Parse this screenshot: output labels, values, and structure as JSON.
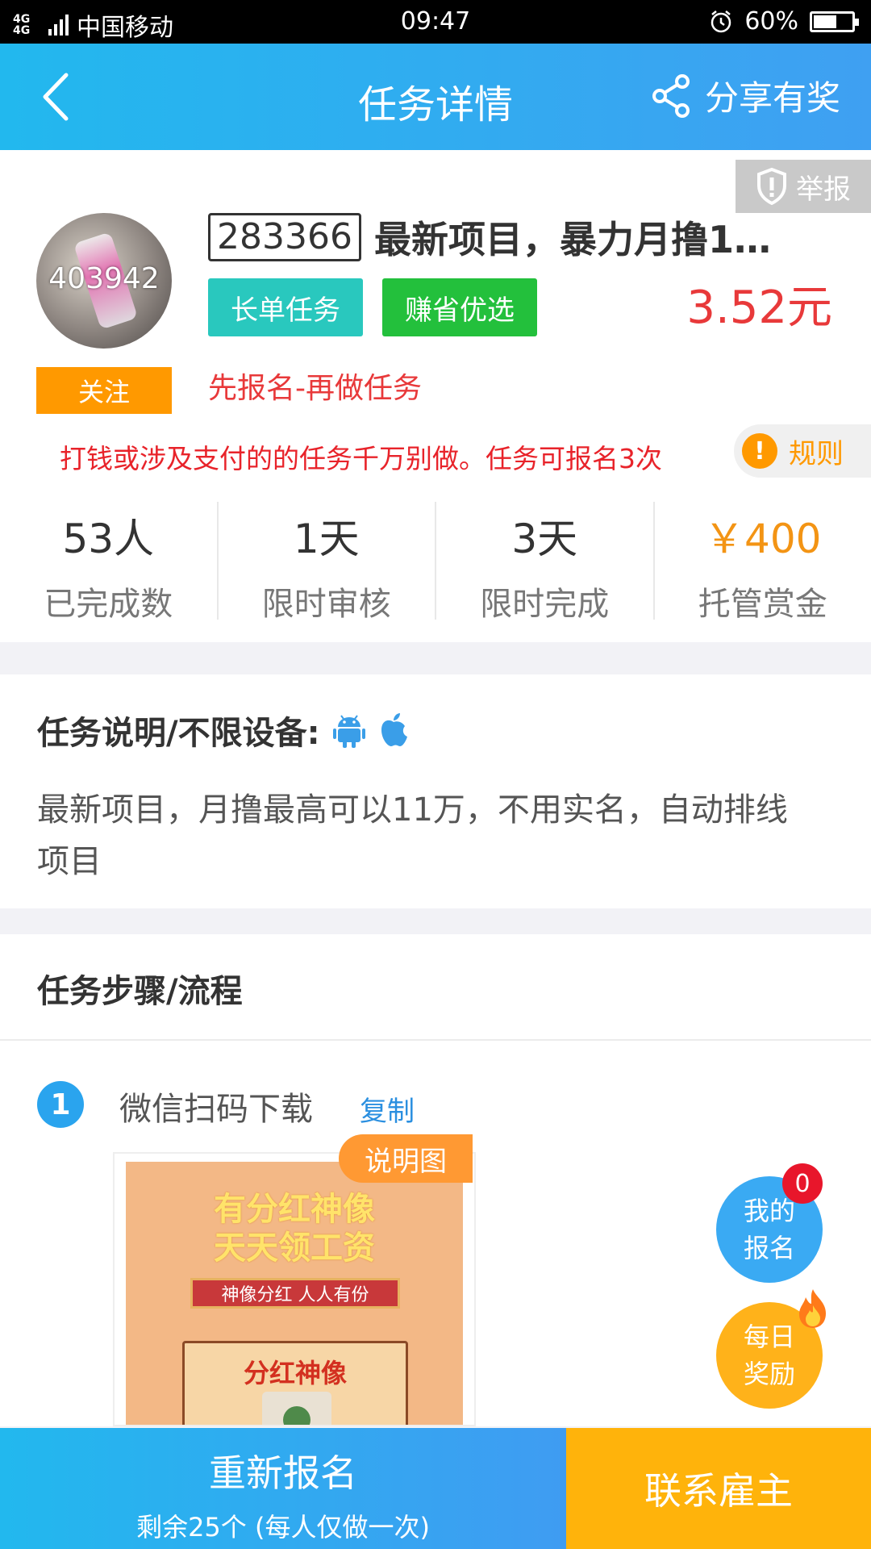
{
  "status_bar": {
    "network": "4G 4G",
    "carrier": "中国移动",
    "time": "09:47",
    "battery": "60%",
    "battery_level": 0.6
  },
  "header": {
    "title": "任务详情",
    "share_label": "分享有奖",
    "back_icon": "chevron-left-icon",
    "share_icon": "share-icon"
  },
  "task": {
    "report_label": "举报",
    "avatar_text": "403942",
    "follow_label": "关注",
    "id": "283366",
    "name": "最新项目，暴力月撸1…",
    "tags": [
      "长单任务",
      "赚省优选"
    ],
    "price": "3.52元",
    "hint": "先报名-再做任务",
    "warning": "打钱或涉及支付的的任务千万别做。任务可报名3次",
    "rules_label": "规则"
  },
  "stats": [
    {
      "value": "53人",
      "label": "已完成数"
    },
    {
      "value": "1天",
      "label": "限时审核"
    },
    {
      "value": "3天",
      "label": "限时完成"
    },
    {
      "value": "￥400",
      "label": "托管赏金"
    }
  ],
  "description": {
    "heading": "任务说明/不限设备:",
    "body": "最新项目，月撸最高可以11万，不用实名，自动排线项目",
    "device_icons": [
      "android-icon",
      "apple-icon"
    ]
  },
  "steps": {
    "heading": "任务步骤/流程",
    "items": [
      {
        "number": "1",
        "text": "微信扫码下载",
        "copy_label": "复制"
      }
    ],
    "image_badge": "说明图",
    "poster": {
      "line1": "有分红神像",
      "line2": "天天领工资",
      "ribbon": "神像分红 人人有份",
      "box_title": "分红神像"
    }
  },
  "float_buttons": {
    "my_signup": [
      "我的",
      "报名"
    ],
    "my_signup_count": "0",
    "daily_reward": [
      "每日",
      "奖励"
    ]
  },
  "bottom": {
    "reapply_label": "重新报名",
    "reapply_sub": "剩余25个 (每人仅做一次)",
    "contact_label": "联系雇主"
  },
  "colors": {
    "accent_blue": "#22b8ee",
    "price_red": "#e8393a",
    "orange": "#ff9900",
    "teal_tag": "#29c8be",
    "green_tag": "#23c03c",
    "contact_yellow": "#ffb30b"
  }
}
